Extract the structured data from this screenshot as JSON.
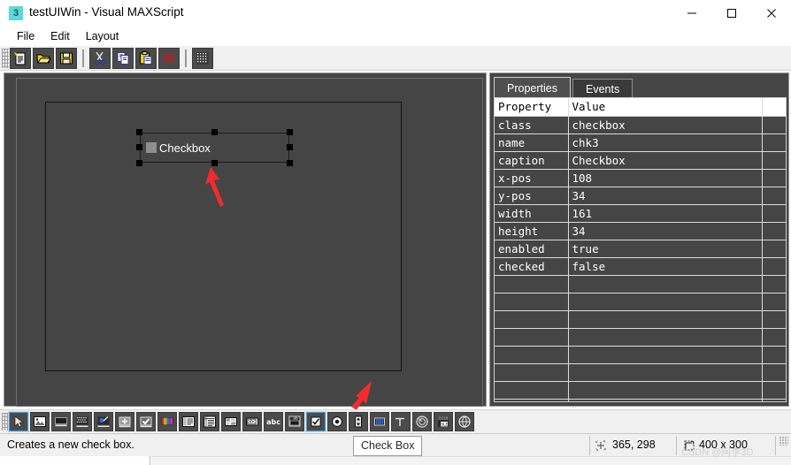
{
  "window": {
    "title": "testUIWin - Visual MAXScript",
    "icon_label": "3",
    "icon_name": "maxscript-app-icon",
    "minimize": "─",
    "maximize": "□",
    "close": "✕"
  },
  "menu": {
    "items": [
      {
        "label": "File"
      },
      {
        "label": "Edit"
      },
      {
        "label": "Layout"
      }
    ]
  },
  "toolbar": {
    "buttons": [
      {
        "name": "new-icon",
        "tip": "New"
      },
      {
        "name": "open-icon",
        "tip": "Open"
      },
      {
        "name": "save-icon",
        "tip": "Save"
      },
      {
        "name": "cut-icon",
        "tip": "Cut"
      },
      {
        "name": "copy-icon",
        "tip": "Copy"
      },
      {
        "name": "paste-icon",
        "tip": "Paste"
      },
      {
        "name": "delete-icon",
        "tip": "Delete"
      },
      {
        "name": "grid-icon",
        "tip": "Grid"
      }
    ]
  },
  "canvas": {
    "control": {
      "type": "checkbox",
      "caption": "Checkbox",
      "checked": false
    }
  },
  "properties_panel": {
    "tabs": [
      {
        "label": "Properties",
        "active": true
      },
      {
        "label": "Events",
        "active": false
      }
    ],
    "columns": [
      "Property",
      "Value"
    ],
    "rows": [
      {
        "property": "class",
        "value": "checkbox"
      },
      {
        "property": "name",
        "value": "chk3"
      },
      {
        "property": "caption",
        "value": "Checkbox"
      },
      {
        "property": "x-pos",
        "value": "108"
      },
      {
        "property": "y-pos",
        "value": "34"
      },
      {
        "property": "width",
        "value": "161"
      },
      {
        "property": "height",
        "value": "34"
      },
      {
        "property": "enabled",
        "value": "true"
      },
      {
        "property": "checked",
        "value": "false"
      },
      {
        "property": "",
        "value": ""
      },
      {
        "property": "",
        "value": ""
      },
      {
        "property": "",
        "value": ""
      },
      {
        "property": "",
        "value": ""
      },
      {
        "property": "",
        "value": ""
      },
      {
        "property": "",
        "value": ""
      },
      {
        "property": "",
        "value": ""
      },
      {
        "property": "",
        "value": ""
      }
    ]
  },
  "control_toolbar": {
    "buttons": [
      {
        "name": "pointer-select-icon",
        "tip": "Select",
        "selected": true
      },
      {
        "name": "bitmap-icon",
        "tip": "Bitmap"
      },
      {
        "name": "label-icon",
        "tip": "Label"
      },
      {
        "name": "groupbox-icon",
        "tip": "Group Box"
      },
      {
        "name": "colorpicker-icon",
        "tip": "Color Picker"
      },
      {
        "name": "button-icon",
        "tip": "Button"
      },
      {
        "name": "checkbutton-icon",
        "tip": "Check Button"
      },
      {
        "name": "colorswatch-icon",
        "tip": "Color Swatch"
      },
      {
        "name": "listbox-icon",
        "tip": "List Box"
      },
      {
        "name": "multilistbox-icon",
        "tip": "Multi List Box"
      },
      {
        "name": "combobox-icon",
        "tip": "Combo Box"
      },
      {
        "name": "editbox-icon",
        "tip": "Edit Box"
      },
      {
        "name": "boldtext-icon",
        "tip": "Text"
      },
      {
        "name": "dropdownlist-icon",
        "tip": "Drop-down List"
      },
      {
        "name": "checkbox-icon",
        "tip": "Check Box",
        "selected": true
      },
      {
        "name": "radiobutton-icon",
        "tip": "Radio Button"
      },
      {
        "name": "spinner-icon",
        "tip": "Spinner"
      },
      {
        "name": "slider-icon",
        "tip": "Slider"
      },
      {
        "name": "angle-icon",
        "tip": "Angle"
      },
      {
        "name": "dial-icon",
        "tip": "Dial"
      },
      {
        "name": "activex-icon",
        "tip": "ActiveX / OLE"
      },
      {
        "name": "mapbutton-icon",
        "tip": "Map Button"
      }
    ]
  },
  "status_bar": {
    "hint": "Creates a new check box.",
    "tooltip": "Check Box",
    "coordinates": "365, 298",
    "size": "400 x 300",
    "coord_icon": "crosshair-position-icon",
    "size_icon": "dimensions-icon"
  },
  "watermark": {
    "text": "CSDN @阿李3D"
  }
}
